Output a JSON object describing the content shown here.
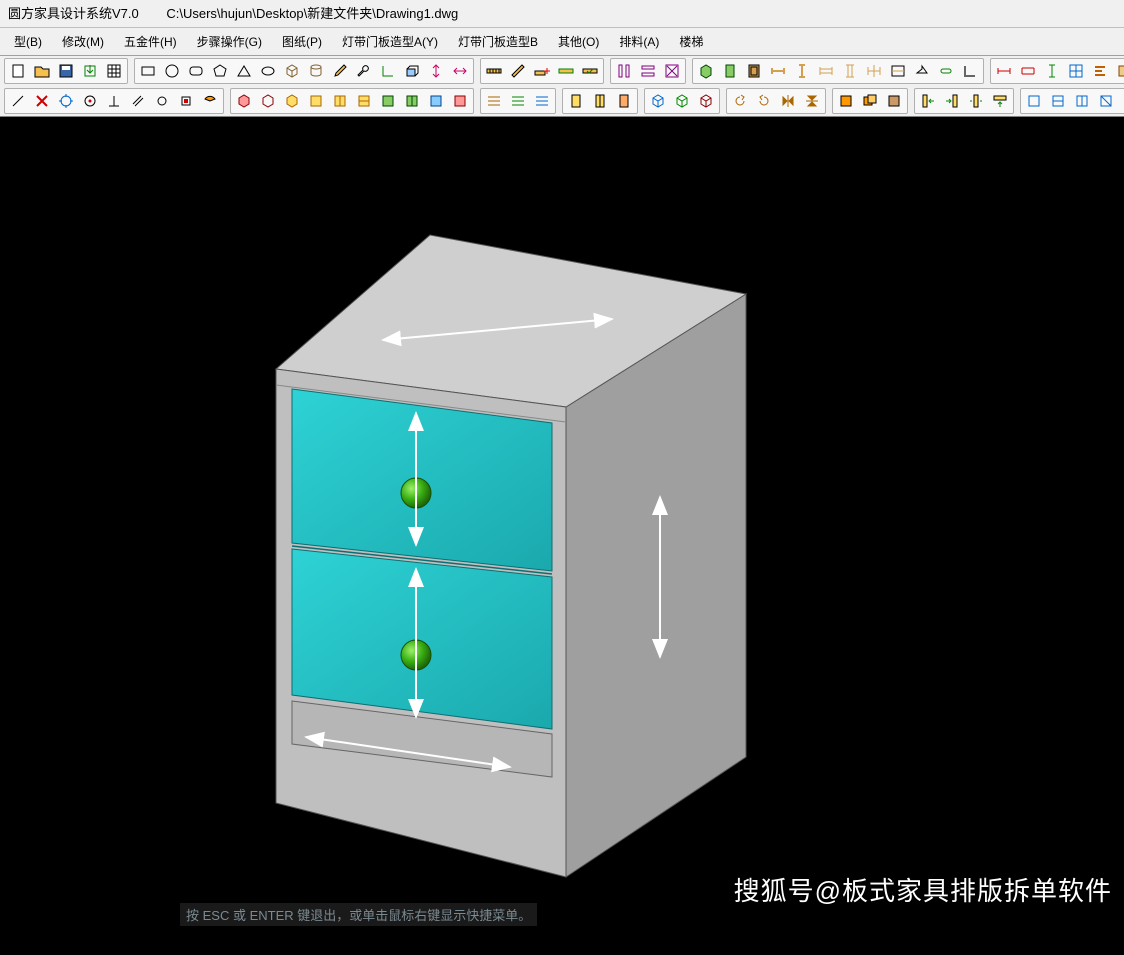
{
  "title": {
    "app": "圆方家具设计系统V7.0",
    "path": "C:\\Users\\hujun\\Desktop\\新建文件夹\\Drawing1.dwg"
  },
  "menu": {
    "items": [
      {
        "label": "型(B)"
      },
      {
        "label": "修改(M)"
      },
      {
        "label": "五金件(H)"
      },
      {
        "label": "步骤操作(G)"
      },
      {
        "label": "图纸(P)"
      },
      {
        "label": "灯带门板造型A(Y)"
      },
      {
        "label": "灯带门板造型B"
      },
      {
        "label": "其他(O)"
      },
      {
        "label": "排料(A)"
      },
      {
        "label": "楼梯"
      }
    ]
  },
  "watermark": "搜狐号@板式家具排版拆单软件",
  "statushint": "按  ESC  或  ENTER  键退出，或单击鼠标右键显示快捷菜单。",
  "colors": {
    "drawer": "#24bcc0",
    "knob": "#3bb015",
    "top": "#cfcfcf",
    "side": "#9f9f9f",
    "front": "#bfbfbf"
  }
}
